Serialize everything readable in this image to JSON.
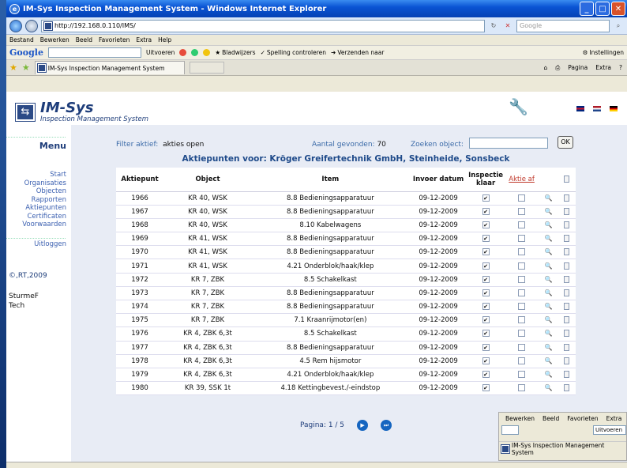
{
  "window": {
    "title": "IM-Sys Inspection Management System - Windows Internet Explorer",
    "url": "http://192.168.0.110/IMS/",
    "search_placeholder": "Google"
  },
  "menubar": [
    "Bestand",
    "Bewerken",
    "Beeld",
    "Favorieten",
    "Extra",
    "Help"
  ],
  "toolbar": {
    "google": "Google",
    "uitvoeren": "Uitvoeren",
    "bladwijzers": "Bladwijzers",
    "spelling": "Spelling controleren",
    "verzenden": "Verzenden naar",
    "instellingen": "Instellingen"
  },
  "tab": {
    "title": "IM-Sys Inspection Management System"
  },
  "tab_tools": {
    "pagina": "Pagina",
    "extra": "Extra"
  },
  "app": {
    "logo": "IM-Sys",
    "subtitle": "Inspection Management System"
  },
  "sidebar": {
    "menu_title": "Menu",
    "items": [
      "Start",
      "Organisaties",
      "Objecten",
      "Rapporten",
      "Aktiepunten",
      "Certificaten",
      "Voorwaarden"
    ],
    "logout": "Uitloggen",
    "copyright": "©,RT,2009",
    "user_line1": "SturmeF",
    "user_line2": "Tech"
  },
  "filter": {
    "label": "Filter aktief:",
    "value": "akties open",
    "count_label": "Aantal gevonden:",
    "count_value": "70",
    "search_label": "Zoeken object:",
    "ok": "OK"
  },
  "heading": "Aktiepunten voor: Kröger Greifertechnik GmbH, Steinheide, Sonsbeck",
  "columns": {
    "aktiepunt": "Aktiepunt",
    "object": "Object",
    "item": "Item",
    "datum": "Invoer datum",
    "inspectie": "Inspectie klaar",
    "aktie_af": "Aktie af"
  },
  "rows": [
    {
      "id": "1966",
      "object": "KR 40, WSK",
      "item": "8.8 Bedieningsapparatuur",
      "date": "09-12-2009"
    },
    {
      "id": "1967",
      "object": "KR 40, WSK",
      "item": "8.8 Bedieningsapparatuur",
      "date": "09-12-2009"
    },
    {
      "id": "1968",
      "object": "KR 40, WSK",
      "item": "8.10 Kabelwagens",
      "date": "09-12-2009"
    },
    {
      "id": "1969",
      "object": "KR 41, WSK",
      "item": "8.8 Bedieningsapparatuur",
      "date": "09-12-2009"
    },
    {
      "id": "1970",
      "object": "KR 41, WSK",
      "item": "8.8 Bedieningsapparatuur",
      "date": "09-12-2009"
    },
    {
      "id": "1971",
      "object": "KR 41, WSK",
      "item": "4.21 Onderblok/haak/klep",
      "date": "09-12-2009"
    },
    {
      "id": "1972",
      "object": "KR 7, ZBK",
      "item": "8.5 Schakelkast",
      "date": "09-12-2009"
    },
    {
      "id": "1973",
      "object": "KR 7, ZBK",
      "item": "8.8 Bedieningsapparatuur",
      "date": "09-12-2009"
    },
    {
      "id": "1974",
      "object": "KR 7, ZBK",
      "item": "8.8 Bedieningsapparatuur",
      "date": "09-12-2009"
    },
    {
      "id": "1975",
      "object": "KR 7, ZBK",
      "item": "7.1 Kraanrijmotor(en)",
      "date": "09-12-2009"
    },
    {
      "id": "1976",
      "object": "KR 4, ZBK 6,3t",
      "item": "8.5 Schakelkast",
      "date": "09-12-2009"
    },
    {
      "id": "1977",
      "object": "KR 4, ZBK 6,3t",
      "item": "8.8 Bedieningsapparatuur",
      "date": "09-12-2009"
    },
    {
      "id": "1978",
      "object": "KR 4, ZBK 6,3t",
      "item": "4.5 Rem hijsmotor",
      "date": "09-12-2009"
    },
    {
      "id": "1979",
      "object": "KR 4, ZBK 6,3t",
      "item": "4.21 Onderblok/haak/klep",
      "date": "09-12-2009"
    },
    {
      "id": "1980",
      "object": "KR 39, SSK 1t",
      "item": "4.18 Kettingbevest./-eindstop",
      "date": "09-12-2009"
    }
  ],
  "pager": {
    "label": "Pagina: 1 / 5"
  },
  "popup": {
    "menu": [
      "Bewerken",
      "Beeld",
      "Favorieten",
      "Extra"
    ],
    "uitvoeren": "Uitvoeren",
    "tab": "IM-Sys Inspection Management System"
  }
}
